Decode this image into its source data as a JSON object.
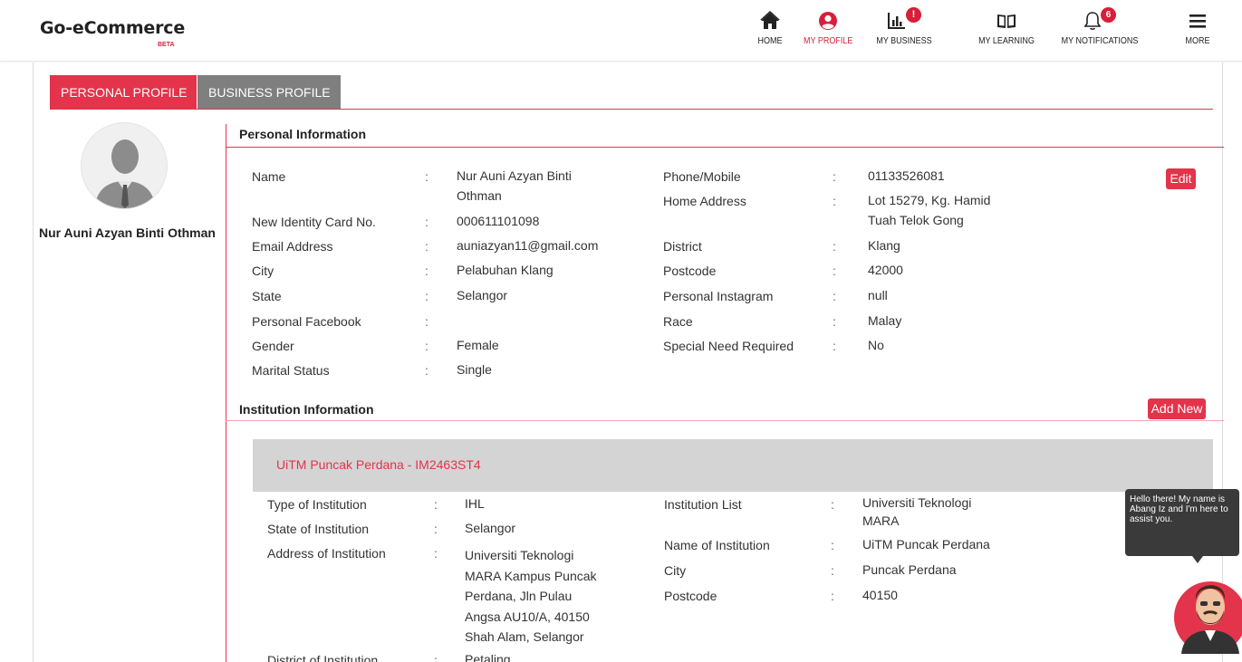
{
  "header": {
    "brand": "Go-eCommerce",
    "beta": "BETA",
    "nav": [
      {
        "label": "HOME",
        "icon": "home-icon"
      },
      {
        "label": "MY PROFILE",
        "icon": "user-circle-icon"
      },
      {
        "label": "MY BUSINESS",
        "icon": "bar-chart-icon"
      },
      {
        "label": "MY LEARNING",
        "icon": "book-icon"
      },
      {
        "label": "MY NOTIFICATIONS",
        "icon": "bell-icon",
        "badge": "6"
      },
      {
        "label": "MORE",
        "icon": "menu-icon"
      }
    ]
  },
  "tabs": {
    "personal": "PERSONAL PROFILE",
    "business": "BUSINESS PROFILE"
  },
  "profile": {
    "name": "Nur Auni Azyan Binti Othman"
  },
  "personal_info": {
    "title": "Personal Information",
    "edit": "Edit",
    "left": [
      {
        "label": "Name",
        "value": "Nur Auni Azyan Binti Othman"
      },
      {
        "label": "New Identity Card No.",
        "value": "000611101098"
      },
      {
        "label": "Email Address",
        "value": "auniazyan11@gmail.com"
      },
      {
        "label": "City",
        "value": "Pelabuhan Klang"
      },
      {
        "label": "State",
        "value": "Selangor"
      },
      {
        "label": "Personal Facebook",
        "value": ""
      },
      {
        "label": "Gender",
        "value": "Female"
      },
      {
        "label": "Marital Status",
        "value": "Single"
      }
    ],
    "right": [
      {
        "label": "Phone/Mobile",
        "value": "01133526081"
      },
      {
        "label": "Home Address",
        "value": "Lot 15279, Kg. Hamid Tuah Telok Gong"
      },
      {
        "label": "District",
        "value": "Klang"
      },
      {
        "label": "Postcode",
        "value": "42000"
      },
      {
        "label": "Personal Instagram",
        "value": "null"
      },
      {
        "label": "Race",
        "value": "Malay"
      },
      {
        "label": "Special Need Required",
        "value": "No"
      }
    ]
  },
  "institution_info": {
    "title": "Institution Information",
    "add_new": "Add New",
    "card_title": "UiTM Puncak Perdana - IM2463ST4",
    "left": [
      {
        "label": "Type of Institution",
        "value": "IHL"
      },
      {
        "label": "State of Institution",
        "value": "Selangor"
      },
      {
        "label": "Address of Institution",
        "value": "Universiti Teknologi MARA Kampus Puncak Perdana, Jln Pulau Angsa AU10/A, 40150 Shah Alam, Selangor"
      },
      {
        "label": "District of Institution",
        "value": "Petaling"
      }
    ],
    "right": [
      {
        "label": "Institution List",
        "value": "Universiti Teknologi MARA"
      },
      {
        "label": "Name of Institution",
        "value": "UiTM Puncak Perdana"
      },
      {
        "label": "City",
        "value": "Puncak Perdana"
      },
      {
        "label": "Postcode",
        "value": "40150"
      }
    ]
  },
  "chat": {
    "greeting": "Hello there! My name is Abang Iz and I'm here to assist you."
  },
  "colors": {
    "accent": "#e3344b",
    "tab_inactive": "#7f7f7f"
  }
}
